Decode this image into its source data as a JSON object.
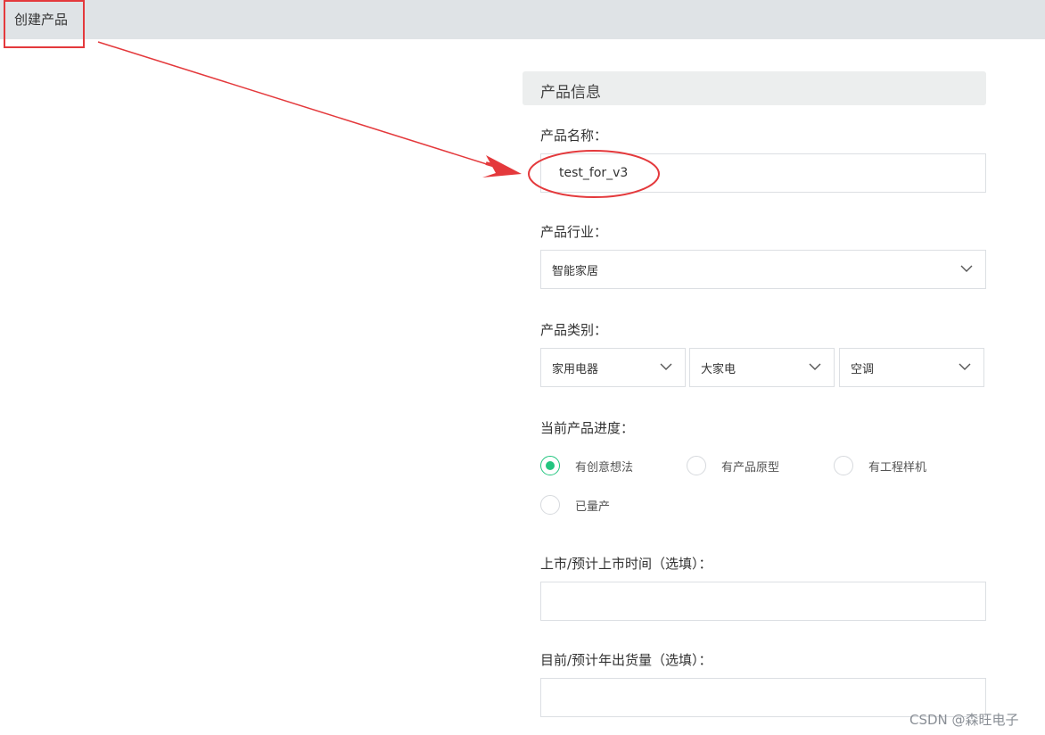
{
  "breadcrumb": "创建产品",
  "section": {
    "title": "产品信息"
  },
  "product_name": {
    "label": "产品名称：",
    "value": "test_for_v3"
  },
  "industry": {
    "label": "产品行业：",
    "value": "智能家居"
  },
  "category": {
    "label": "产品类别：",
    "levels": [
      "家用电器",
      "大家电",
      "空调"
    ]
  },
  "progress": {
    "label": "当前产品进度：",
    "options": [
      {
        "label": "有创意想法",
        "checked": true
      },
      {
        "label": "有产品原型",
        "checked": false
      },
      {
        "label": "有工程样机",
        "checked": false
      },
      {
        "label": "已量产",
        "checked": false
      }
    ]
  },
  "launch_time": {
    "label": "上市/预计上市时间（选填）：",
    "value": ""
  },
  "annual_shipment": {
    "label": "目前/预计年出货量（选填）：",
    "value": ""
  },
  "watermark": "CSDN @森旺电子",
  "colors": {
    "accent": "#22c57f",
    "annotation": "#e4393c",
    "topbar": "#dfe3e6"
  }
}
